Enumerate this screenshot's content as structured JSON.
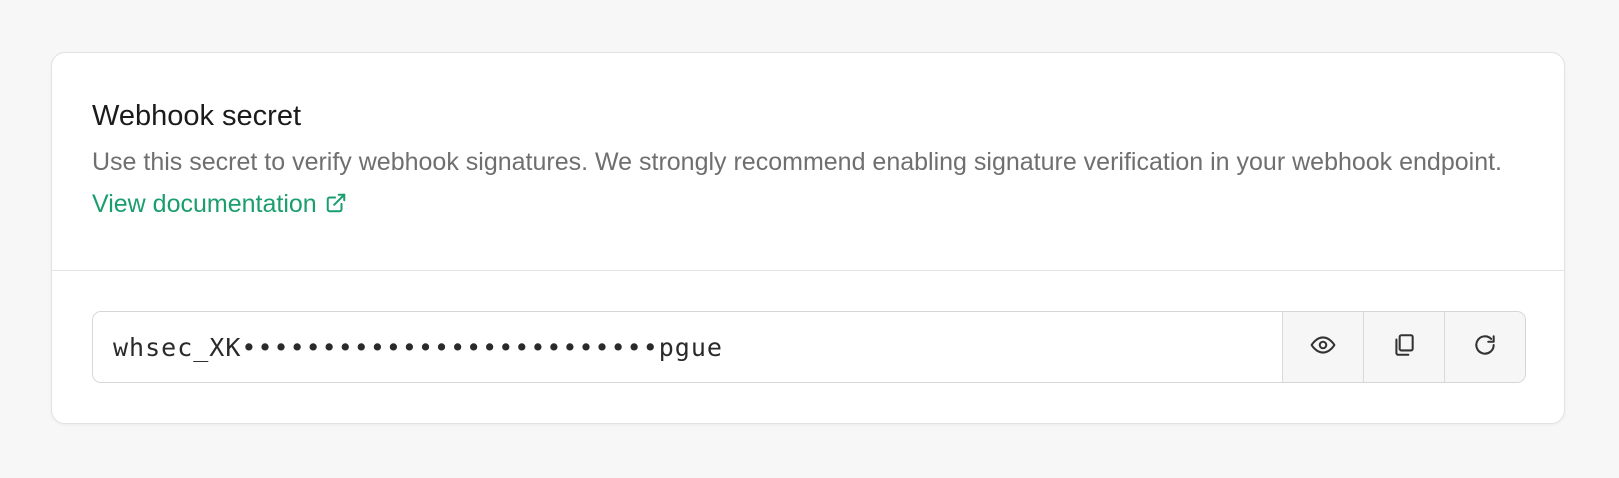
{
  "section": {
    "title": "Webhook secret",
    "description": "Use this secret to verify webhook signatures. We strongly recommend enabling signature verification in your webhook endpoint.",
    "doc_link_label": "View documentation",
    "doc_link_icon": "external-link-icon",
    "link_color": "#1a9e6e"
  },
  "secret": {
    "value": "whsec_XK••••••••••••••••••••••••••pgue"
  },
  "actions": [
    {
      "icon": "eye-icon",
      "action": "reveal"
    },
    {
      "icon": "copy-icon",
      "action": "copy"
    },
    {
      "icon": "refresh-icon",
      "action": "regenerate"
    }
  ]
}
